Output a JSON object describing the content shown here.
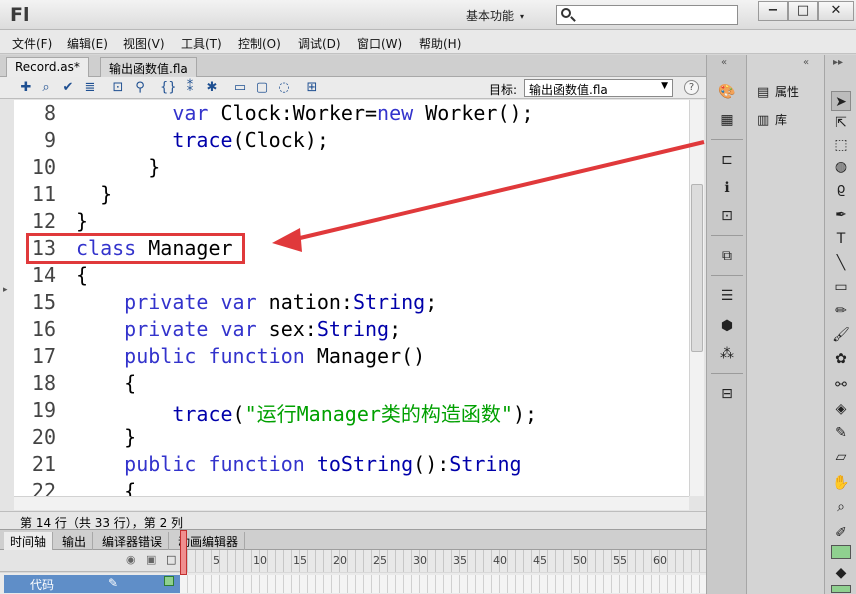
{
  "app": {
    "logo": "Fl",
    "workspace": "基本功能",
    "window_controls": {
      "minimize": "−",
      "maximize": "□",
      "close": "✕"
    }
  },
  "menu": [
    "文件(F)",
    "编辑(E)",
    "视图(V)",
    "工具(T)",
    "控制(O)",
    "调试(D)",
    "窗口(W)",
    "帮助(H)"
  ],
  "doc_tabs": [
    {
      "label": "Record.as*",
      "active": true
    },
    {
      "label": "输出函数值.fla",
      "active": false
    }
  ],
  "toolbar": {
    "icons": [
      "add-statement-icon",
      "find-icon",
      "check-syntax-icon",
      "auto-format-icon",
      "code-hint-icon",
      "debug-options-icon",
      "collapse-braces-icon",
      "collapse-selection-icon",
      "expand-all-icon",
      "comment-block-icon",
      "comment-line-icon",
      "remove-comment-icon",
      "show-hide-toolbox-icon"
    ],
    "target_label": "目标:",
    "target_value": "输出函数值.fla",
    "help": "?"
  },
  "code": {
    "lines": [
      {
        "num": "8",
        "indent": "        ",
        "tokens": [
          [
            "kw",
            "var"
          ],
          [
            "plain",
            " Clock:Worker="
          ],
          [
            "kw",
            "new"
          ],
          [
            "plain",
            " Worker();"
          ]
        ]
      },
      {
        "num": "9",
        "indent": "        ",
        "tokens": [
          [
            "fn",
            "trace"
          ],
          [
            "plain",
            "(Clock);"
          ]
        ]
      },
      {
        "num": "10",
        "indent": "      ",
        "tokens": [
          [
            "plain",
            "}"
          ]
        ]
      },
      {
        "num": "11",
        "indent": "  ",
        "tokens": [
          [
            "plain",
            "}"
          ]
        ]
      },
      {
        "num": "12",
        "indent": "",
        "tokens": [
          [
            "plain",
            "}"
          ]
        ]
      },
      {
        "num": "13",
        "indent": "",
        "tokens": [
          [
            "kw",
            "class"
          ],
          [
            "plain",
            " Manager"
          ]
        ]
      },
      {
        "num": "14",
        "indent": "",
        "tokens": [
          [
            "plain",
            "{"
          ]
        ]
      },
      {
        "num": "15",
        "indent": "    ",
        "tokens": [
          [
            "kw",
            "private var"
          ],
          [
            "plain",
            " nation:"
          ],
          [
            "ty",
            "String"
          ],
          [
            "plain",
            ";"
          ]
        ]
      },
      {
        "num": "16",
        "indent": "    ",
        "tokens": [
          [
            "kw",
            "private var"
          ],
          [
            "plain",
            " sex:"
          ],
          [
            "ty",
            "String"
          ],
          [
            "plain",
            ";"
          ]
        ]
      },
      {
        "num": "17",
        "indent": "    ",
        "tokens": [
          [
            "kw",
            "public function"
          ],
          [
            "plain",
            " Manager()"
          ]
        ]
      },
      {
        "num": "18",
        "indent": "    ",
        "tokens": [
          [
            "plain",
            "{"
          ]
        ]
      },
      {
        "num": "19",
        "indent": "        ",
        "tokens": [
          [
            "fn",
            "trace"
          ],
          [
            "plain",
            "("
          ],
          [
            "str",
            "\"运行Manager类的构造函数\""
          ],
          [
            "plain",
            ");"
          ]
        ]
      },
      {
        "num": "20",
        "indent": "    ",
        "tokens": [
          [
            "plain",
            "}"
          ]
        ]
      },
      {
        "num": "21",
        "indent": "    ",
        "tokens": [
          [
            "kw",
            "public function"
          ],
          [
            "plain",
            " "
          ],
          [
            "fn",
            "toString"
          ],
          [
            "plain",
            "():"
          ],
          [
            "ty",
            "String"
          ]
        ]
      },
      {
        "num": "22",
        "indent": "    ",
        "tokens": [
          [
            "plain",
            "{"
          ]
        ]
      }
    ]
  },
  "status": "第 14 行（共 33 行），第 2 列",
  "timeline": {
    "tabs": [
      "时间轴",
      "输出",
      "编译器错误",
      "动画编辑器"
    ],
    "frame_numbers": [
      "1",
      "5",
      "10",
      "15",
      "20",
      "25",
      "30",
      "35",
      "40",
      "45",
      "50",
      "55",
      "60"
    ],
    "layer_name": "代码"
  },
  "panels": {
    "properties": "属性",
    "library": "库"
  },
  "colors": {
    "keyword": "#3333cc",
    "string": "#00a000",
    "highlight": "#e0393b",
    "layer": "#5f8ec8"
  }
}
